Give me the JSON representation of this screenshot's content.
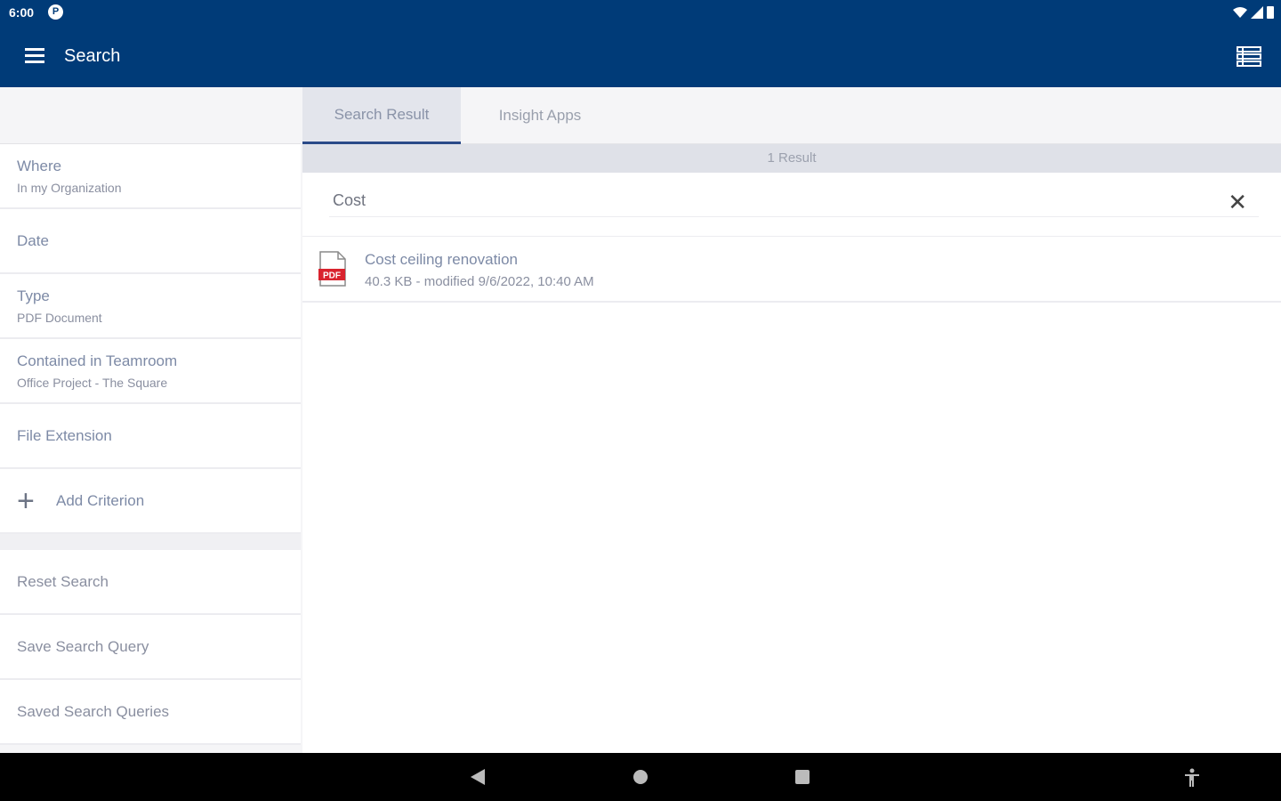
{
  "status_bar": {
    "time": "6:00",
    "notification_glyph": "P"
  },
  "app_bar": {
    "title": "Search"
  },
  "criteria": [
    {
      "label": "Where",
      "value": "In my Organization"
    },
    {
      "label": "Date",
      "value": ""
    },
    {
      "label": "Type",
      "value": "PDF Document"
    },
    {
      "label": "Contained in Teamroom",
      "value": "Office Project - The Square"
    },
    {
      "label": "File Extension",
      "value": ""
    }
  ],
  "add_criterion": {
    "icon": "plus-icon",
    "label": "Add Criterion"
  },
  "actions": {
    "reset": "Reset Search",
    "save": "Save Search Query",
    "saved": "Saved Search Queries"
  },
  "tabs": {
    "search_result": "Search Result",
    "insight_apps": "Insight Apps"
  },
  "results": {
    "count_label": "1 Result",
    "query": "Cost",
    "items": [
      {
        "name": "Cost ceiling renovation",
        "meta": "40.3 KB - modified 9/6/2022, 10:40 AM",
        "icon_text": "PDF"
      }
    ]
  },
  "colors": {
    "primary": "#003b78",
    "accent_red": "#d9232e",
    "label_blue": "#7d8aa6"
  }
}
